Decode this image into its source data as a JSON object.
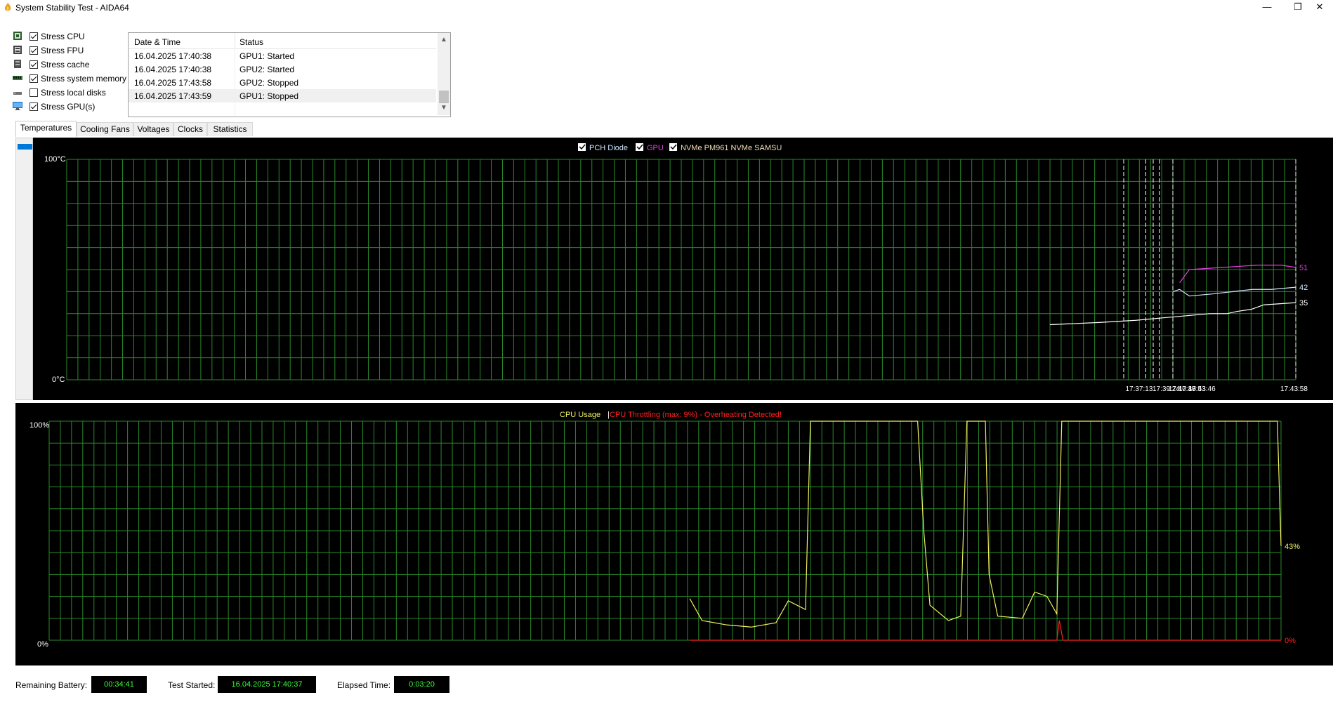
{
  "window": {
    "title": "System Stability Test - AIDA64",
    "minimize_glyph": "—",
    "maximize_glyph": "❐",
    "close_glyph": "✕"
  },
  "stress_options": [
    {
      "label": "Stress CPU",
      "checked": true,
      "icon": "cpu-chip-icon"
    },
    {
      "label": "Stress FPU",
      "checked": true,
      "icon": "fpu-chip-icon"
    },
    {
      "label": "Stress cache",
      "checked": true,
      "icon": "cache-chip-icon"
    },
    {
      "label": "Stress system memory",
      "checked": true,
      "icon": "memory-module-icon"
    },
    {
      "label": "Stress local disks",
      "checked": false,
      "icon": "disk-drive-icon"
    },
    {
      "label": "Stress GPU(s)",
      "checked": true,
      "icon": "monitor-icon"
    }
  ],
  "log": {
    "columns": [
      "Date & Time",
      "Status"
    ],
    "rows": [
      {
        "time": "16.04.2025 17:40:38",
        "status": "GPU1: Started"
      },
      {
        "time": "16.04.2025 17:40:38",
        "status": "GPU2: Started"
      },
      {
        "time": "16.04.2025 17:43:58",
        "status": "GPU2: Stopped"
      },
      {
        "time": "16.04.2025 17:43:59",
        "status": "GPU1: Stopped"
      }
    ]
  },
  "tabs": [
    "Temperatures",
    "Cooling Fans",
    "Voltages",
    "Clocks",
    "Statistics"
  ],
  "active_tab": "Temperatures",
  "temperature_legend": [
    {
      "label": "PCH Diode",
      "checked": true,
      "color": "#d0e8ff"
    },
    {
      "label": "GPU",
      "checked": true,
      "color": "#e040e0"
    },
    {
      "label": "NVMe PM961 NVMe SAMSU",
      "checked": true,
      "color": "#f5deb3"
    }
  ],
  "cpu_chart_title": {
    "usage_label": "CPU Usage",
    "separator": "|",
    "throttle_label": "CPU Throttling (max: 9%) - Overheating Detected!",
    "usage_color": "#f0f060",
    "throttle_color": "#ff2020"
  },
  "chart_data": [
    {
      "type": "line",
      "ylim": [
        0,
        100
      ],
      "y_top_label": "100°C",
      "y_bottom_label": "0°C",
      "x_labels": [
        "17:37:13",
        "17:39:24",
        "17:40:38",
        "17:40:53",
        "17:43:46",
        "17:43:58"
      ],
      "series": [
        {
          "name": "GPU",
          "color": "#e040e0",
          "end_label": "51",
          "points": [
            [
              0.755,
              44
            ],
            [
              0.765,
              50
            ],
            [
              0.8,
              51
            ],
            [
              0.835,
              52
            ],
            [
              0.86,
              52
            ],
            [
              0.875,
              51
            ]
          ]
        },
        {
          "name": "PCH Diode",
          "color": "#d0e8ff",
          "end_label": "42",
          "points": [
            [
              0.748,
              40
            ],
            [
              0.755,
              41
            ],
            [
              0.765,
              38
            ],
            [
              0.79,
              39
            ],
            [
              0.81,
              40
            ],
            [
              0.83,
              41
            ],
            [
              0.85,
              41
            ],
            [
              0.875,
              42
            ]
          ]
        },
        {
          "name": "NVMe PM961 NVMe SAMSU",
          "color": "#ffffff",
          "end_label": "35",
          "points": [
            [
              0.0,
              25
            ],
            [
              0.2,
              26
            ],
            [
              0.35,
              27
            ],
            [
              0.45,
              28
            ],
            [
              0.55,
              29
            ],
            [
              0.65,
              30
            ],
            [
              0.72,
              30
            ],
            [
              0.76,
              31
            ],
            [
              0.82,
              32
            ],
            [
              0.87,
              34
            ],
            [
              1.0,
              35
            ]
          ]
        }
      ]
    },
    {
      "type": "line",
      "ylim": [
        0,
        100
      ],
      "y_top_label": "100%",
      "y_bottom_label": "0%",
      "series": [
        {
          "name": "CPU Usage",
          "color": "#f0f060",
          "end_label": "43%",
          "points": [
            [
              0.52,
              19
            ],
            [
              0.53,
              9
            ],
            [
              0.55,
              7
            ],
            [
              0.57,
              6
            ],
            [
              0.59,
              8
            ],
            [
              0.6,
              18
            ],
            [
              0.614,
              14
            ],
            [
              0.618,
              100
            ],
            [
              0.705,
              100
            ],
            [
              0.71,
              50
            ],
            [
              0.715,
              16
            ],
            [
              0.73,
              9
            ],
            [
              0.74,
              11
            ],
            [
              0.745,
              100
            ],
            [
              0.76,
              100
            ],
            [
              0.763,
              30
            ],
            [
              0.77,
              11
            ],
            [
              0.79,
              10
            ],
            [
              0.8,
              22
            ],
            [
              0.81,
              20
            ],
            [
              0.818,
              12
            ],
            [
              0.822,
              100
            ],
            [
              0.997,
              100
            ],
            [
              1.0,
              43
            ]
          ]
        },
        {
          "name": "CPU Throttling",
          "color": "#ff2020",
          "end_label": "0%",
          "points": [
            [
              0.52,
              0
            ],
            [
              0.818,
              0
            ],
            [
              0.82,
              9
            ],
            [
              0.823,
              0
            ],
            [
              1.0,
              0
            ]
          ]
        }
      ]
    }
  ],
  "status": {
    "battery_label": "Remaining Battery:",
    "battery_value": "00:34:41",
    "started_label": "Test Started:",
    "started_value": "16.04.2025 17:40:37",
    "elapsed_label": "Elapsed Time:",
    "elapsed_value": "0:03:20"
  }
}
